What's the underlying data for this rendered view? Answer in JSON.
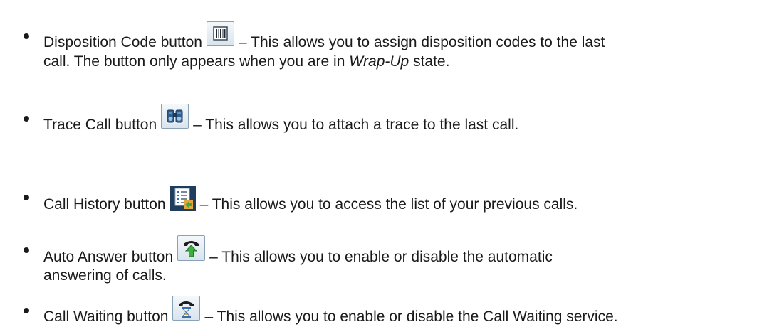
{
  "items": [
    {
      "label": "Disposition Code button",
      "icon": "barcode-icon",
      "line1": "– This allows you to assign disposition codes to the last",
      "line2_before": "call.  The button only appears when you are in ",
      "line2_em": "Wrap-Up",
      "line2_after": " state."
    },
    {
      "label": "Trace Call button",
      "icon": "binoculars-icon",
      "line1": "– This allows you to attach a trace to the last call."
    },
    {
      "label": "Call History button",
      "icon": "call-history-icon",
      "line1": "– This allows you to access the list of your previous calls."
    },
    {
      "label": "Auto Answer button",
      "icon": "phone-up-arrow-icon",
      "line1": "– This allows you to enable or disable the automatic",
      "line2": "answering of calls."
    },
    {
      "label": "Call Waiting button",
      "icon": "phone-hourglass-icon",
      "line1": "– This allows you to enable or disable the Call Waiting service."
    }
  ]
}
